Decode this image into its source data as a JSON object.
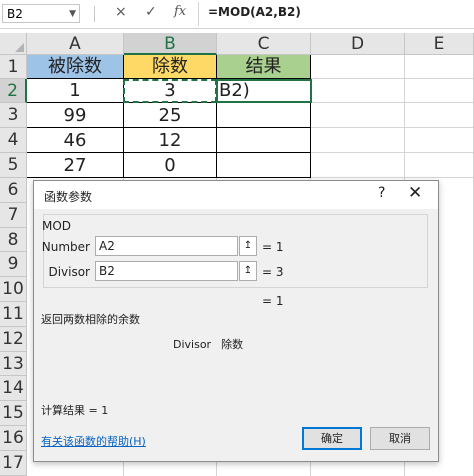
{
  "formula_bar": {
    "name_box": "B2",
    "cancel_icon": "×",
    "enter_icon": "✓",
    "fx_label": "fx",
    "formula": "=MOD(A2,B2)"
  },
  "columns": [
    "A",
    "B",
    "C",
    "D",
    "E"
  ],
  "rows": [
    "1",
    "2",
    "3",
    "4",
    "5",
    "6",
    "7",
    "8",
    "9",
    "10",
    "11",
    "12",
    "13",
    "14",
    "15",
    "16",
    "17"
  ],
  "cells": {
    "A1": "被除数",
    "B1": "除数",
    "C1": "结果",
    "A2": "1",
    "B2": "3",
    "C2": "B2)",
    "A3": "99",
    "B3": "25",
    "A4": "46",
    "B4": "12",
    "A5": "27",
    "B5": "0"
  },
  "colors": {
    "header_a": "#9dc3e6",
    "header_b": "#ffd966",
    "header_c": "#a9d08e",
    "selection": "#217346",
    "link": "#0563c1"
  },
  "dialog": {
    "title": "函数参数",
    "help_icon": "?",
    "close_icon": "✕",
    "function_name": "MOD",
    "args": [
      {
        "label": "Number",
        "value": "A2",
        "ref_icon": "↥",
        "equals": "= 1"
      },
      {
        "label": "Divisor",
        "value": "B2",
        "ref_icon": "↥",
        "equals": "= 3"
      }
    ],
    "result_equals": "= 1",
    "description": "返回两数相除的余数",
    "arg_desc_name": "Divisor",
    "arg_desc_text": "除数",
    "calc_result": "计算结果 =   1",
    "help_link": "有关该函数的帮助(H)",
    "ok_label": "确定",
    "cancel_label": "取消"
  }
}
